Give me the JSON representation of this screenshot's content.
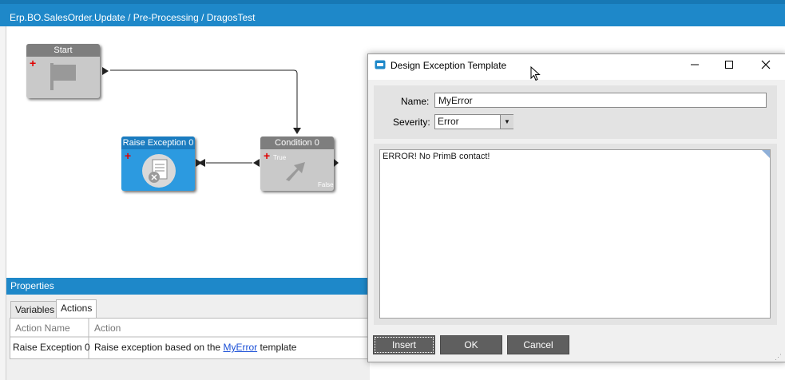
{
  "breadcrumb": "Erp.BO.SalesOrder.Update / Pre-Processing / DragosTest",
  "canvas": {
    "start_node": {
      "label": "Start"
    },
    "condition_node": {
      "label": "Condition 0",
      "true_label": "True",
      "false_label": "False"
    },
    "raise_node": {
      "label": "Raise Exception 0"
    }
  },
  "properties": {
    "title": "Properties",
    "tabs": [
      {
        "label": "Variables"
      },
      {
        "label": "Actions"
      }
    ],
    "active_tab": "Actions",
    "columns": [
      "Action Name",
      "Action"
    ],
    "rows": [
      {
        "name": "Raise Exception 0",
        "action_prefix": "Raise exception based on the ",
        "link": "MyError",
        "action_suffix": " template"
      }
    ]
  },
  "dialog": {
    "title": "Design Exception Template",
    "name_label": "Name:",
    "name_value": "MyError",
    "severity_label": "Severity:",
    "severity_value": "Error",
    "message": "ERROR! No PrimB contact!",
    "buttons": {
      "insert": "Insert",
      "ok": "OK",
      "cancel": "Cancel"
    }
  },
  "colors": {
    "accent": "#1e88c9",
    "node_gray": "#c9c9c9",
    "node_blue": "#2c9ae0",
    "button": "#5f5f5f"
  },
  "icons": [
    "flag-icon",
    "decision-icon",
    "exception-document-icon",
    "minimize-icon",
    "maximize-icon",
    "close-icon",
    "dialog-app-icon",
    "mouse-cursor-icon"
  ]
}
